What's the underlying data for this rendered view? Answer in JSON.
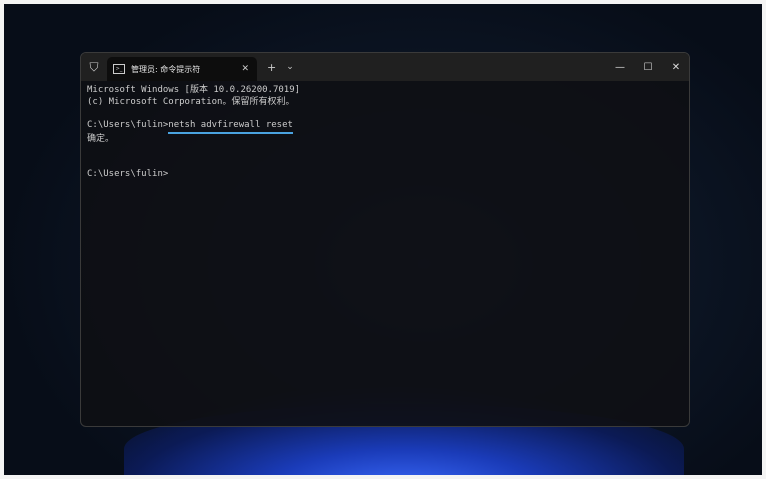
{
  "window": {
    "tab_title": "管理员: 命令提示符",
    "new_tab": "+",
    "dropdown": "⌄",
    "minimize": "—",
    "maximize": "☐",
    "close": "✕",
    "tab_close": "✕"
  },
  "terminal": {
    "line1": "Microsoft Windows [版本 10.0.26200.7019]",
    "line2": "(c) Microsoft Corporation。保留所有权利。",
    "prompt1": "C:\\Users\\fulin>",
    "command": "netsh advfirewall reset",
    "output": "确定。",
    "prompt2": "C:\\Users\\fulin>"
  },
  "colors": {
    "underline": "#4aa3e0"
  }
}
